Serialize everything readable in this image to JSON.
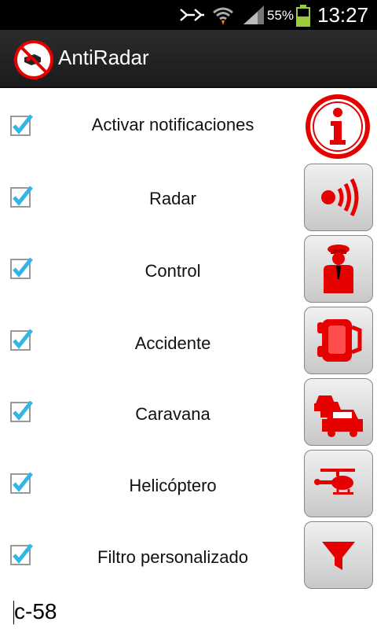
{
  "status": {
    "battery_percent": "55%",
    "clock": "13:27",
    "icons": [
      "mute-icon",
      "wifi-icon",
      "signal-icon",
      "battery-icon"
    ]
  },
  "app": {
    "title": "AntiRadar",
    "icon": "no-radar-icon"
  },
  "rows": [
    {
      "label": "Activar notificaciones",
      "checked": true,
      "icon": "info-icon"
    },
    {
      "label": "Radar",
      "checked": true,
      "icon": "radar-icon"
    },
    {
      "label": "Control",
      "checked": true,
      "icon": "police-officer-icon"
    },
    {
      "label": "Accidente",
      "checked": true,
      "icon": "car-accident-icon"
    },
    {
      "label": "Caravana",
      "checked": true,
      "icon": "traffic-jam-icon"
    },
    {
      "label": "Helicóptero",
      "checked": true,
      "icon": "helicopter-icon"
    },
    {
      "label": "Filtro personalizado",
      "checked": true,
      "icon": "filter-icon"
    }
  ],
  "footer": {
    "input_value": "c-58"
  },
  "colors": {
    "accent_red": "#e60000",
    "checkbox_blue": "#33b5e5",
    "action_bar": "#222222"
  }
}
